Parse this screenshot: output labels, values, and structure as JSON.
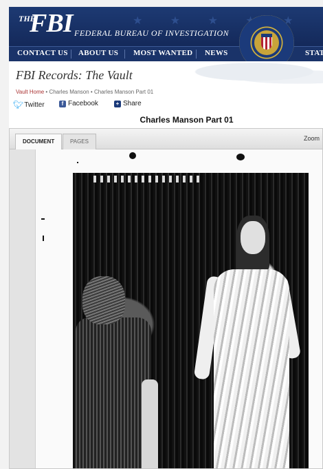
{
  "header": {
    "logo_the": "THE",
    "logo_fbi": "FBI",
    "agency": "FEDERAL BUREAU OF INVESTIGATION"
  },
  "nav": {
    "items": [
      "CONTACT US",
      "ABOUT US",
      "MOST WANTED",
      "NEWS",
      "STAT"
    ]
  },
  "site_title": "FBI Records: The Vault",
  "breadcrumb": {
    "home": "Vault Home",
    "sep": " • ",
    "level2": "Charles Manson",
    "level3": "Charles Manson Part 01"
  },
  "share": {
    "twitter": "Twitter",
    "facebook": "Facebook",
    "share": "Share"
  },
  "document": {
    "title": "Charles Manson Part 01"
  },
  "viewer": {
    "tabs": [
      "DOCUMENT",
      "PAGES"
    ],
    "active_tab": "DOCUMENT",
    "zoom_label": "Zoom"
  },
  "colors": {
    "banner": "#1d3a73",
    "navbar": "#1a3369",
    "seal_gold": "#d4b33b",
    "breadcrumb_link": "#aa3333",
    "twitter": "#1da1f2",
    "facebook": "#3b5998"
  },
  "icons": {
    "twitter": "twitter-bird-icon",
    "facebook": "facebook-f-icon",
    "share": "plus-share-icon"
  }
}
